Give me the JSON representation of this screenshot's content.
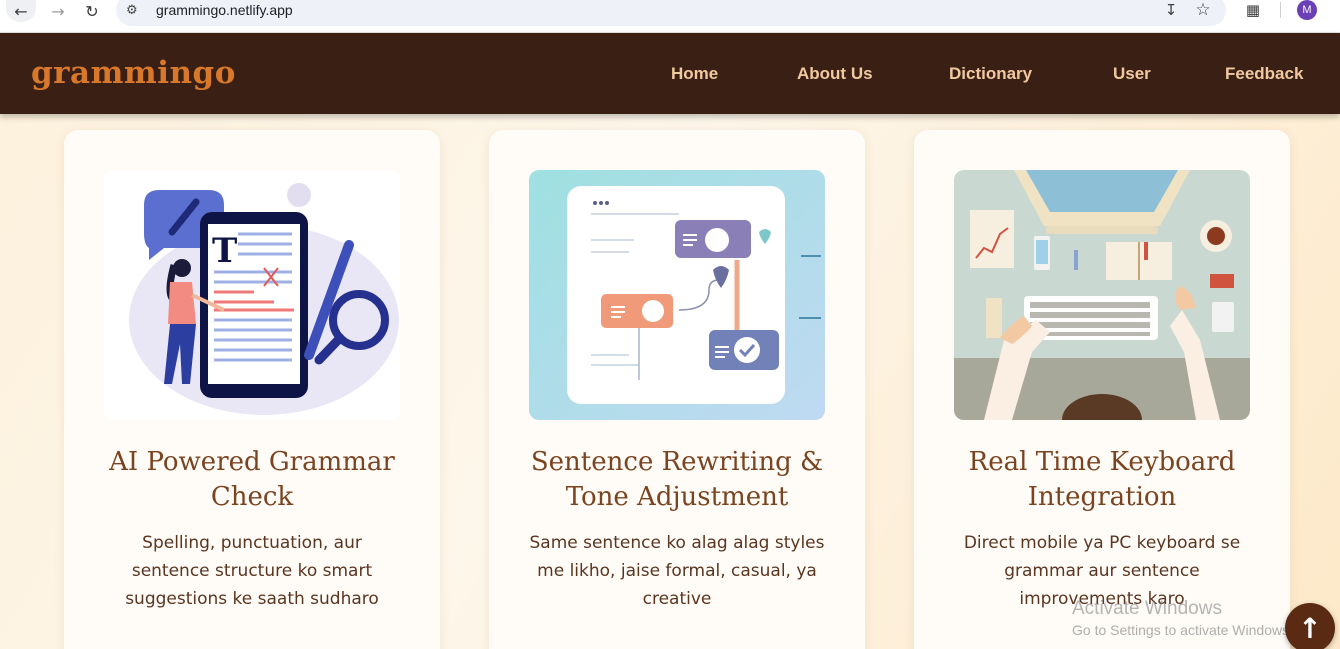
{
  "browser": {
    "back_icon": "arrow-left-icon",
    "forward_icon": "arrow-right-icon",
    "reload_icon": "reload-icon",
    "url": "grammingo.netlify.app",
    "profile_initial": "M"
  },
  "header": {
    "logo": "grammingo",
    "nav": [
      "Home",
      "About Us",
      "Dictionary",
      "User",
      "Feedback"
    ],
    "background": "#3a1f14",
    "logo_color": "#d8782a",
    "nav_color": "#f0c9a0"
  },
  "cards": [
    {
      "title": "AI Powered Grammar Check",
      "description": "Spelling, punctuation, aur sentence structure ko smart suggestions ke saath sudharo"
    },
    {
      "title": "Sentence Rewriting & Tone Adjustment",
      "description": "Same sentence ko alag alag styles me likho, jaise formal, casual, ya creative"
    },
    {
      "title": "Real Time Keyboard Integration",
      "description": "Direct mobile ya PC keyboard se grammar aur sentence improvements karo"
    }
  ],
  "watermark": {
    "line1": "Activate Windows",
    "line2": "Go to Settings to activate Windows."
  },
  "scroll_top_icon": "arrow-up-icon"
}
